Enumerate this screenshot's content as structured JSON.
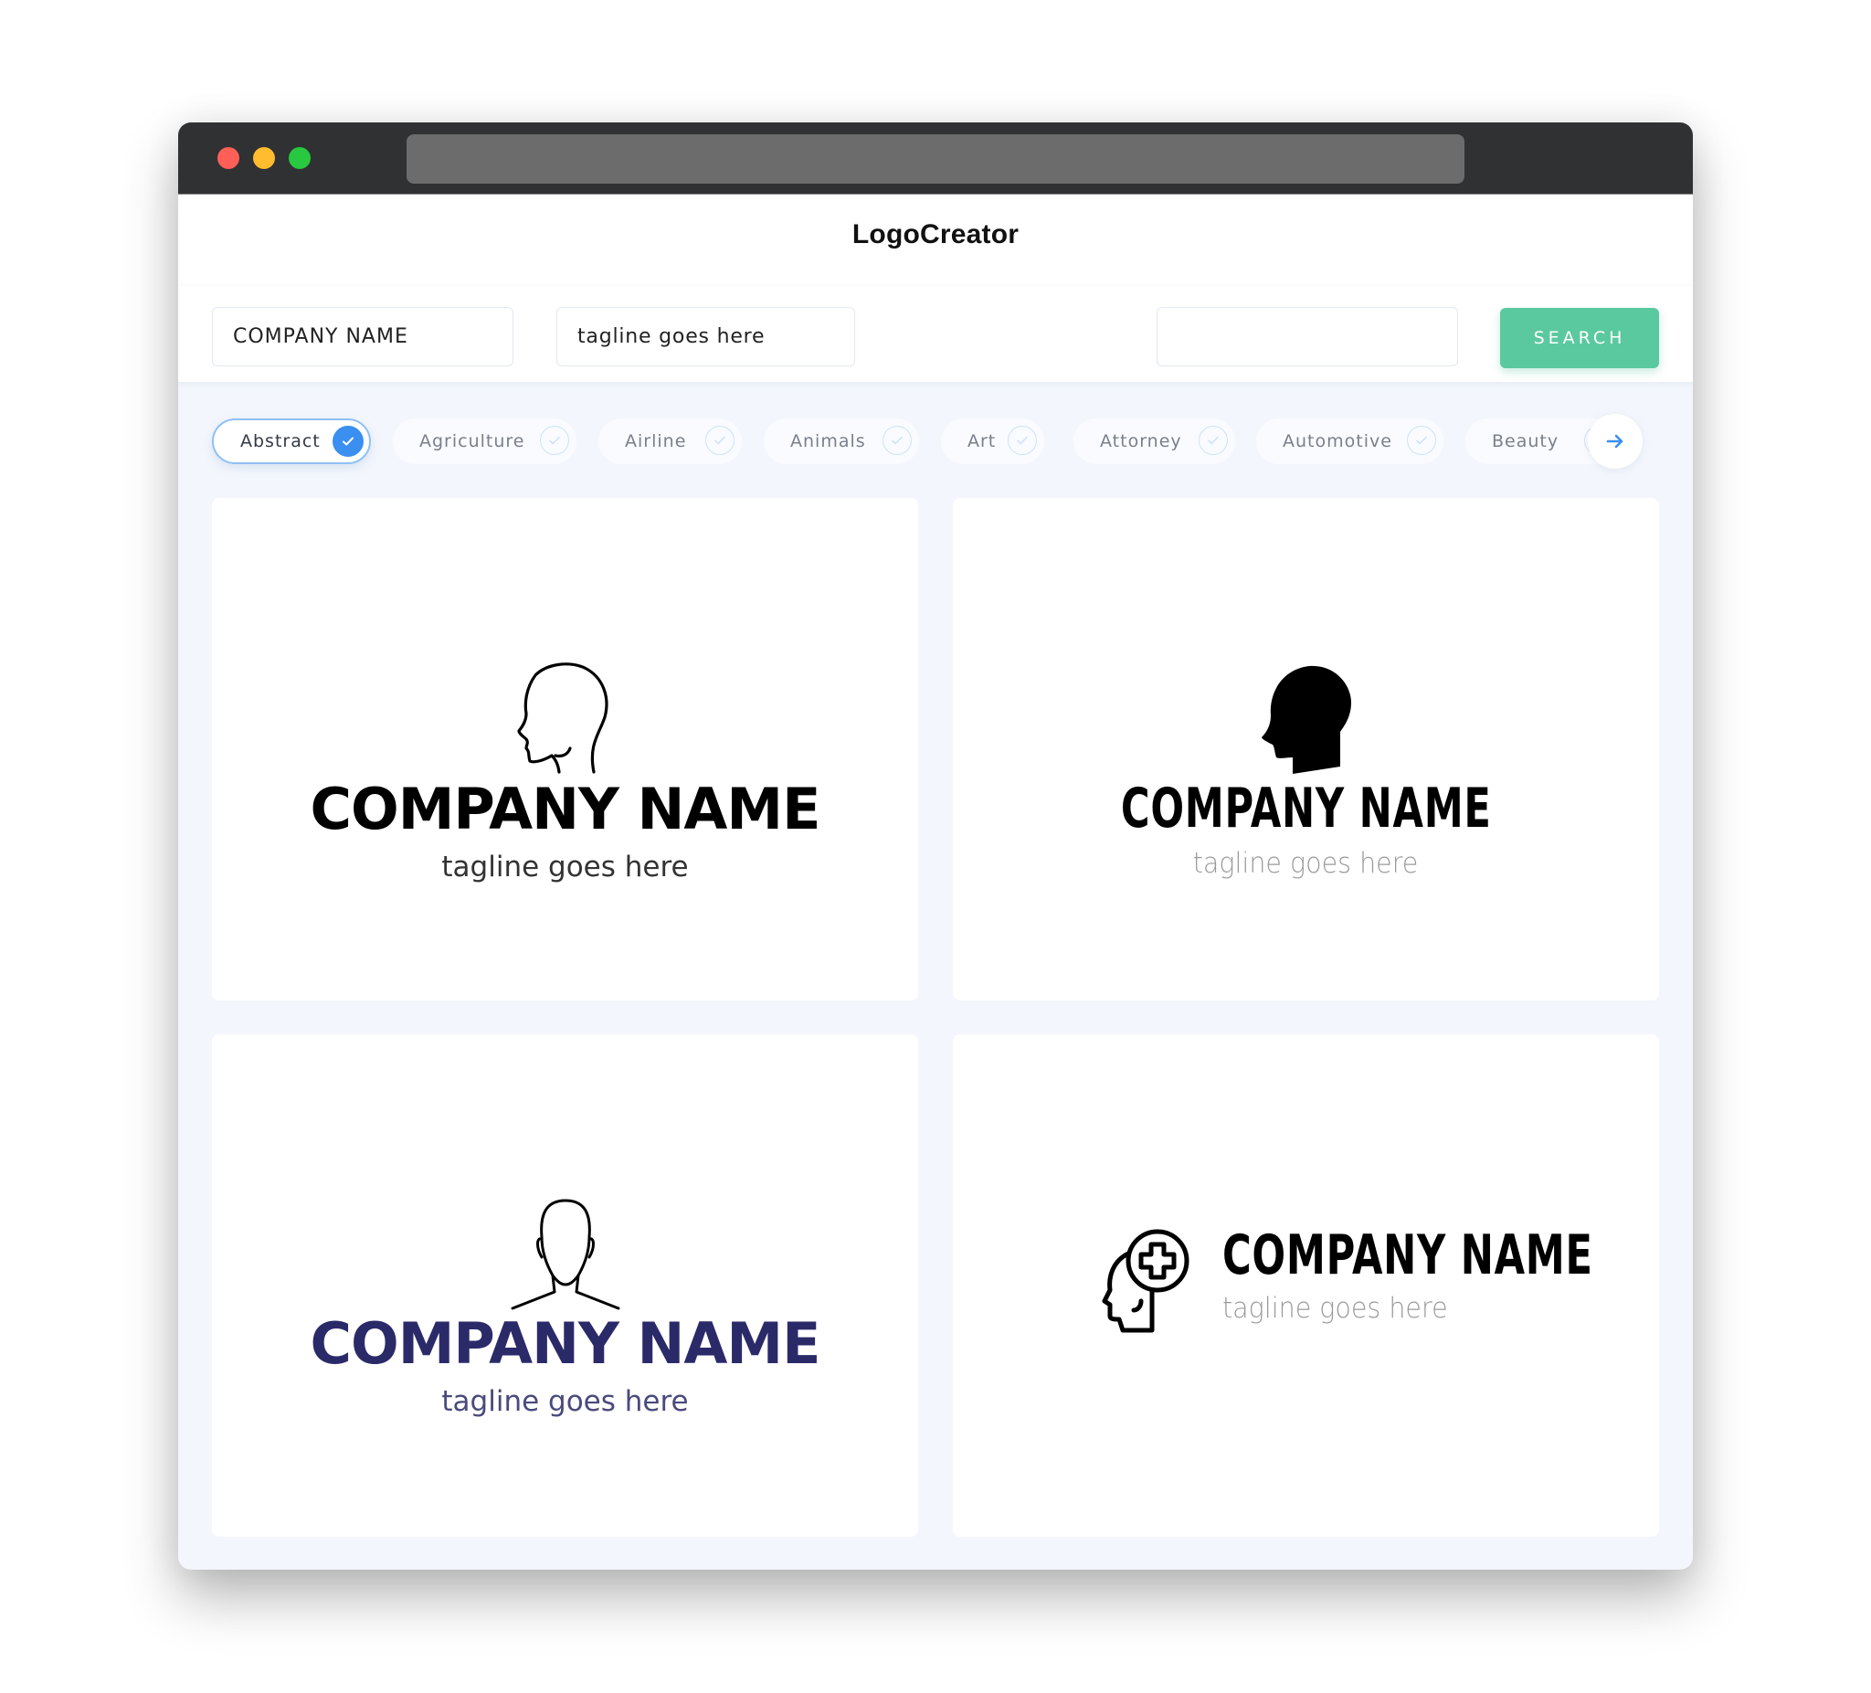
{
  "window": {
    "traffic_lights": [
      "close",
      "minimize",
      "maximize"
    ],
    "address_bar": ""
  },
  "header": {
    "brand": "LogoCreator"
  },
  "toolbar": {
    "company_name_value": "COMPANY NAME",
    "tagline_value": "tagline goes here",
    "search_value": "",
    "search_label": "SEARCH",
    "search_button_color": "#5bc9a0"
  },
  "categories": {
    "items": [
      {
        "label": "Abstract",
        "selected": true
      },
      {
        "label": "Agriculture",
        "selected": false
      },
      {
        "label": "Airline",
        "selected": false
      },
      {
        "label": "Animals",
        "selected": false
      },
      {
        "label": "Art",
        "selected": false
      },
      {
        "label": "Attorney",
        "selected": false
      },
      {
        "label": "Automotive",
        "selected": false
      },
      {
        "label": "Beauty",
        "selected": false
      }
    ],
    "accent_color": "#3a8ff0",
    "next_icon": "arrow-right-icon"
  },
  "logos": [
    {
      "icon": "head-profile-outline-icon",
      "company": "COMPANY NAME",
      "tagline": "tagline goes here",
      "name_color": "#000000",
      "tagline_color": "#333333"
    },
    {
      "icon": "head-profile-solid-icon",
      "company": "COMPANY NAME",
      "tagline": "tagline goes here",
      "name_color": "#000000",
      "tagline_color": "#9a9a9a"
    },
    {
      "icon": "head-front-outline-icon",
      "company": "COMPANY NAME",
      "tagline": "tagline goes here",
      "name_color": "#2b2a69",
      "tagline_color": "#4a4a7c"
    },
    {
      "icon": "head-medical-cross-icon",
      "company": "COMPANY NAME",
      "tagline": "tagline goes here",
      "name_color": "#000000",
      "tagline_color": "#9a9a9a"
    }
  ]
}
